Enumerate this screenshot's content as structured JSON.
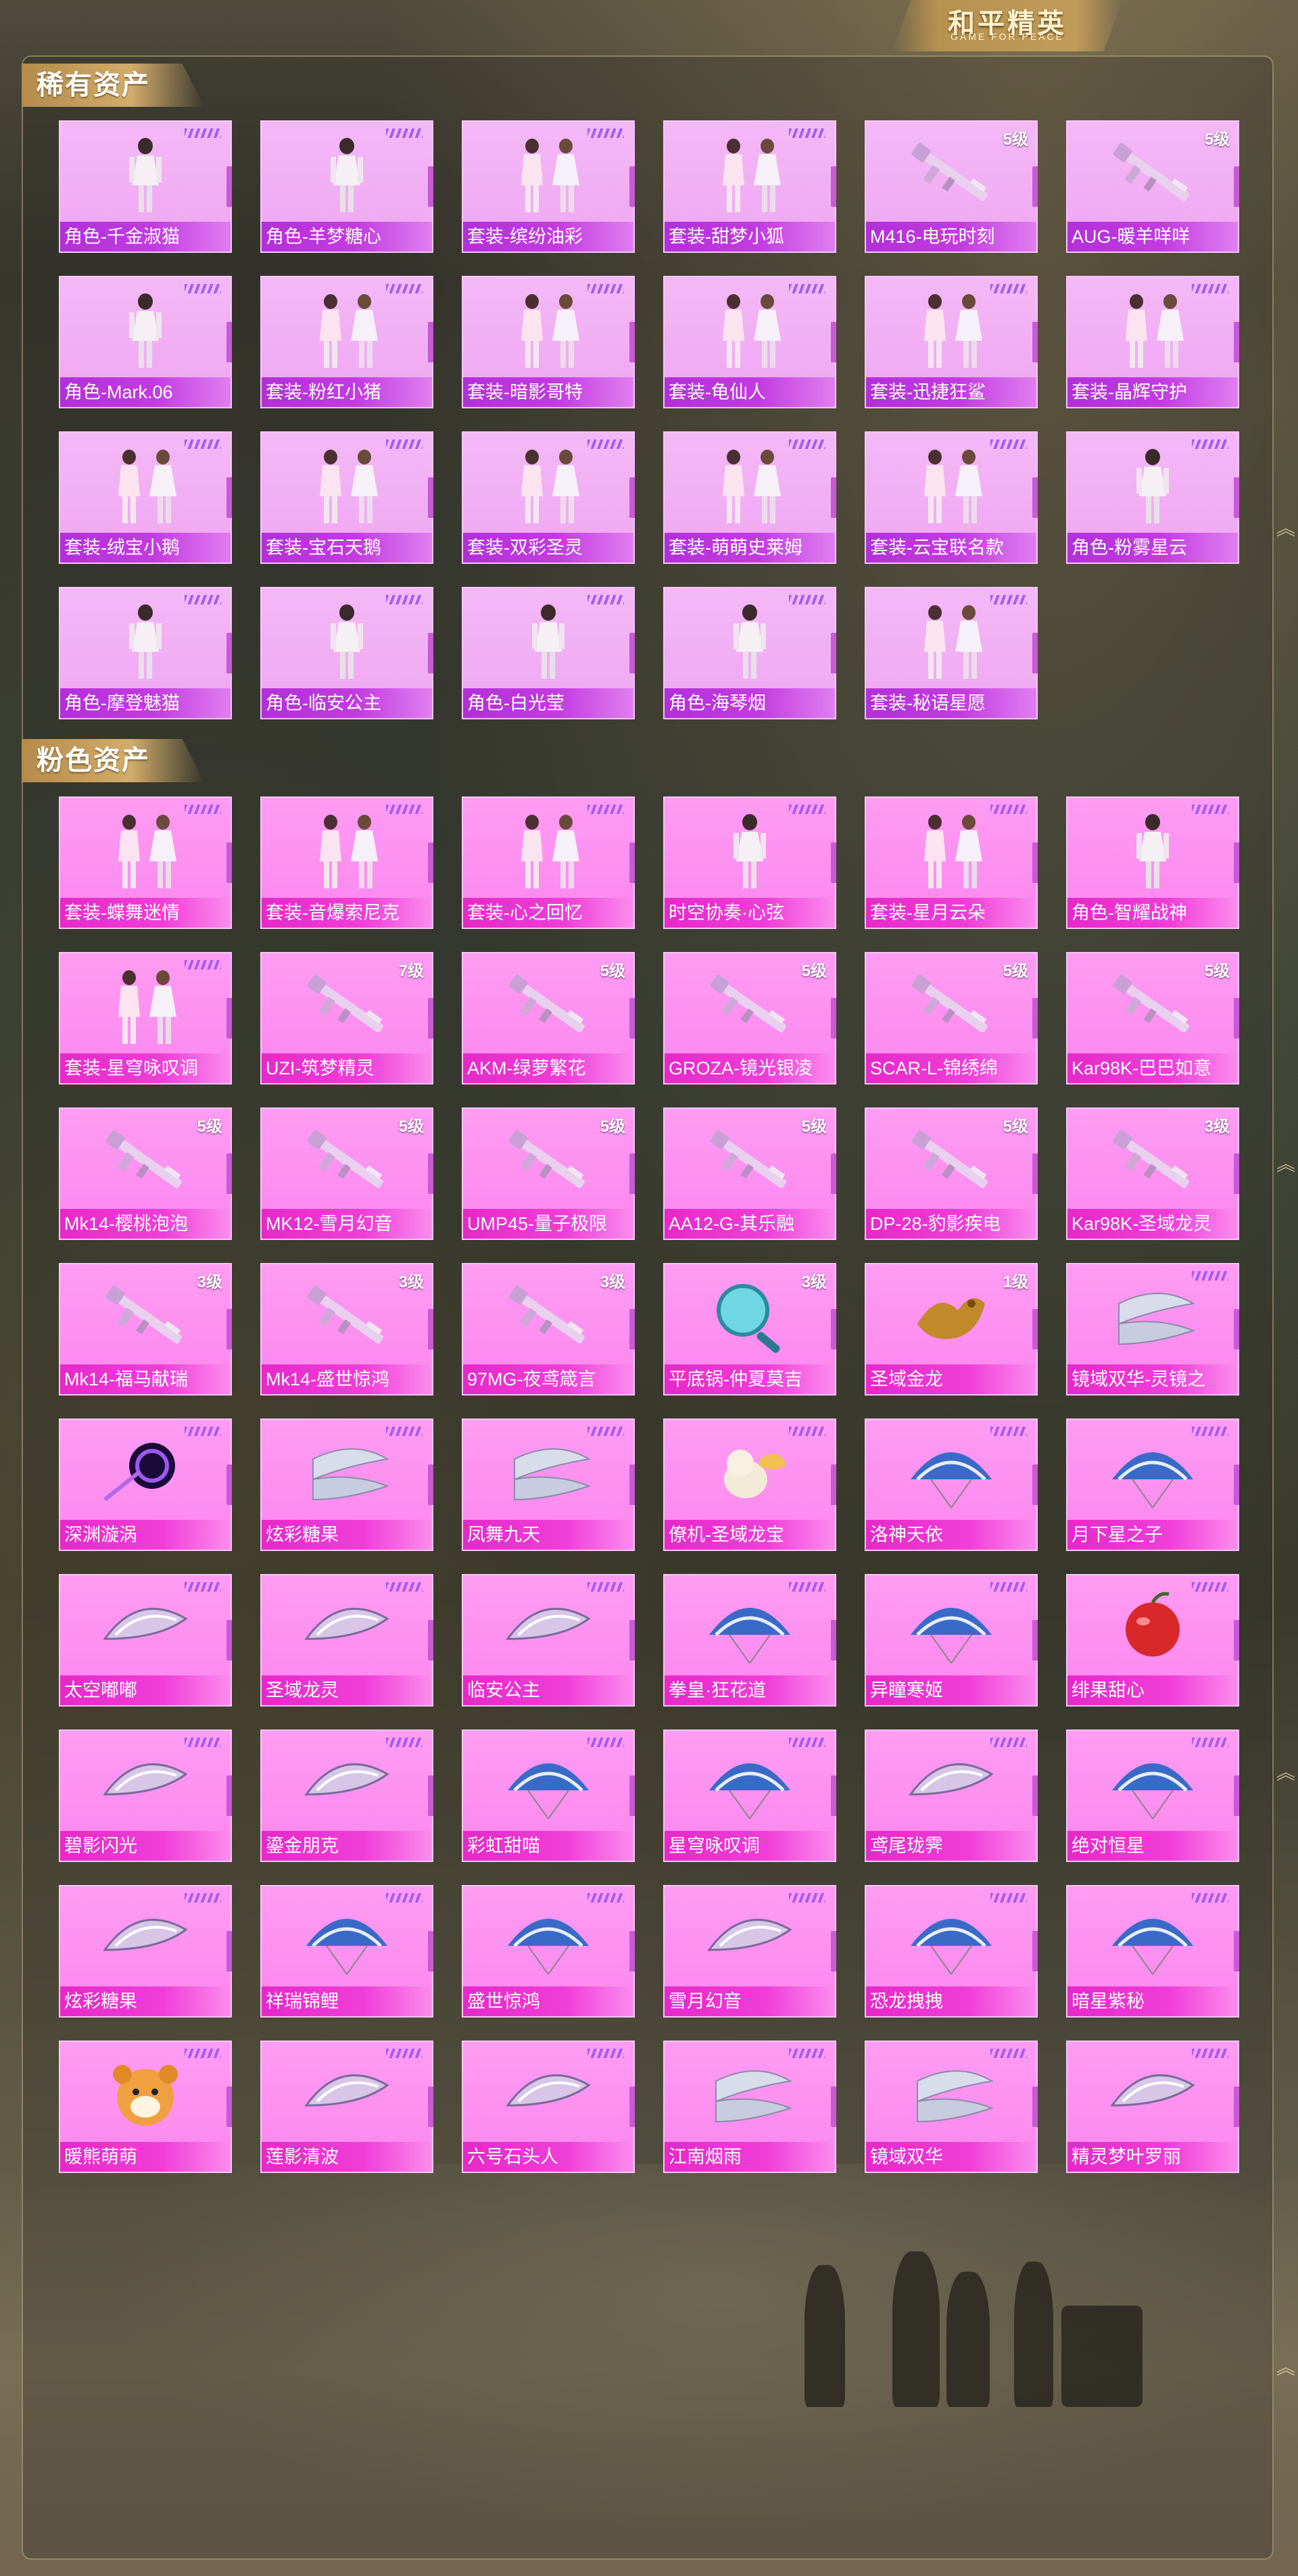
{
  "header": {
    "logo_title": "和平精英",
    "logo_subtitle": "GAME FOR PEACE"
  },
  "sections": {
    "rare": {
      "title": "稀有资产",
      "items": [
        {
          "label": "角色-千金淑猫",
          "level": "",
          "art": "figure"
        },
        {
          "label": "角色-羊梦糖心",
          "level": "",
          "art": "figure"
        },
        {
          "label": "套装-缤纷油彩",
          "level": "",
          "art": "pair"
        },
        {
          "label": "套装-甜梦小狐",
          "level": "",
          "art": "pair"
        },
        {
          "label": "M416-电玩时刻",
          "level": "5级",
          "art": "gun"
        },
        {
          "label": "AUG-暖羊咩咩",
          "level": "5级",
          "art": "gun"
        },
        {
          "label": "角色-Mark.06",
          "level": "",
          "art": "figure"
        },
        {
          "label": "套装-粉红小猪",
          "level": "",
          "art": "pair"
        },
        {
          "label": "套装-暗影哥特",
          "level": "",
          "art": "pair"
        },
        {
          "label": "套装-龟仙人",
          "level": "",
          "art": "pair"
        },
        {
          "label": "套装-迅捷狂鲨",
          "level": "",
          "art": "pair"
        },
        {
          "label": "套装-晶辉守护",
          "level": "",
          "art": "pair"
        },
        {
          "label": "套装-绒宝小鹅",
          "level": "",
          "art": "pair"
        },
        {
          "label": "套装-宝石天鹅",
          "level": "",
          "art": "pair"
        },
        {
          "label": "套装-双彩圣灵",
          "level": "",
          "art": "pair"
        },
        {
          "label": "套装-萌萌史莱姆",
          "level": "",
          "art": "pair"
        },
        {
          "label": "套装-云宝联名款",
          "level": "",
          "art": "pair"
        },
        {
          "label": "角色-粉雾星云",
          "level": "",
          "art": "figure"
        },
        {
          "label": "角色-摩登魅猫",
          "level": "",
          "art": "figure"
        },
        {
          "label": "角色-临安公主",
          "level": "",
          "art": "figure"
        },
        {
          "label": "角色-白光莹",
          "level": "",
          "art": "figure"
        },
        {
          "label": "角色-海琴烟",
          "level": "",
          "art": "figure"
        },
        {
          "label": "套装-秘语星愿",
          "level": "",
          "art": "pair"
        }
      ]
    },
    "pink": {
      "title": "粉色资产",
      "items": [
        {
          "label": "套装-蝶舞迷情",
          "level": "",
          "art": "pair"
        },
        {
          "label": "套装-音爆索尼克",
          "level": "",
          "art": "pair"
        },
        {
          "label": "套装-心之回忆",
          "level": "",
          "art": "pair"
        },
        {
          "label": "时空协奏·心弦",
          "level": "",
          "art": "figure"
        },
        {
          "label": "套装-星月云朵",
          "level": "",
          "art": "pair"
        },
        {
          "label": "角色-智耀战神",
          "level": "",
          "art": "figure"
        },
        {
          "label": "套装-星穹咏叹调",
          "level": "",
          "art": "pair"
        },
        {
          "label": "UZI-筑梦精灵",
          "level": "7级",
          "art": "gun"
        },
        {
          "label": "AKM-绿萝繁花",
          "level": "5级",
          "art": "gun"
        },
        {
          "label": "GROZA-镜光银凌",
          "level": "5级",
          "art": "gun"
        },
        {
          "label": "SCAR-L-锦绣绵",
          "level": "5级",
          "art": "gun"
        },
        {
          "label": "Kar98K-巴巴如意",
          "level": "5级",
          "art": "gun"
        },
        {
          "label": "Mk14-樱桃泡泡",
          "level": "5级",
          "art": "gun"
        },
        {
          "label": "MK12-雪月幻音",
          "level": "5级",
          "art": "gun"
        },
        {
          "label": "UMP45-量子极限",
          "level": "5级",
          "art": "gun"
        },
        {
          "label": "AA12-G-其乐融",
          "level": "5级",
          "art": "gun"
        },
        {
          "label": "DP-28-豹影疾电",
          "level": "5级",
          "art": "gun"
        },
        {
          "label": "Kar98K-圣域龙灵",
          "level": "3级",
          "art": "gun"
        },
        {
          "label": "Mk14-福马献瑞",
          "level": "3级",
          "art": "gun"
        },
        {
          "label": "Mk14-盛世惊鸿",
          "level": "3级",
          "art": "gun"
        },
        {
          "label": "97MG-夜鸢箴言",
          "level": "3级",
          "art": "gun"
        },
        {
          "label": "平底锅-仲夏莫吉",
          "level": "3级",
          "art": "pan"
        },
        {
          "label": "圣域金龙",
          "level": "1级",
          "art": "dragon"
        },
        {
          "label": "镜域双华-灵镜之",
          "level": "",
          "art": "wings"
        },
        {
          "label": "深渊漩涡",
          "level": "",
          "art": "vortex"
        },
        {
          "label": "炫彩糖果",
          "level": "",
          "art": "wings"
        },
        {
          "label": "凤舞九天",
          "level": "",
          "art": "wings"
        },
        {
          "label": "僚机-圣域龙宝",
          "level": "",
          "art": "pet"
        },
        {
          "label": "洛神天依",
          "level": "",
          "art": "chute"
        },
        {
          "label": "月下星之子",
          "level": "",
          "art": "chute"
        },
        {
          "label": "太空嘟嘟",
          "level": "",
          "art": "glider"
        },
        {
          "label": "圣域龙灵",
          "level": "",
          "art": "glider"
        },
        {
          "label": "临安公主",
          "level": "",
          "art": "glider"
        },
        {
          "label": "拳皇·狂花道",
          "level": "",
          "art": "chute"
        },
        {
          "label": "异瞳寒姬",
          "level": "",
          "art": "chute"
        },
        {
          "label": "绯果甜心",
          "level": "",
          "art": "apple"
        },
        {
          "label": "碧影闪光",
          "level": "",
          "art": "glider"
        },
        {
          "label": "鎏金朋克",
          "level": "",
          "art": "glider"
        },
        {
          "label": "彩虹甜喵",
          "level": "",
          "art": "chute"
        },
        {
          "label": "星穹咏叹调",
          "level": "",
          "art": "chute"
        },
        {
          "label": "鸢尾珑霁",
          "level": "",
          "art": "glider"
        },
        {
          "label": "绝对恒星",
          "level": "",
          "art": "chute"
        },
        {
          "label": "炫彩糖果",
          "level": "",
          "art": "glider"
        },
        {
          "label": "祥瑞锦鲤",
          "level": "",
          "art": "chute"
        },
        {
          "label": "盛世惊鸿",
          "level": "",
          "art": "chute"
        },
        {
          "label": "雪月幻音",
          "level": "",
          "art": "glider"
        },
        {
          "label": "恐龙拽拽",
          "level": "",
          "art": "chute"
        },
        {
          "label": "暗星紫秘",
          "level": "",
          "art": "chute"
        },
        {
          "label": "暖熊萌萌",
          "level": "",
          "art": "bear"
        },
        {
          "label": "莲影清波",
          "level": "",
          "art": "glider"
        },
        {
          "label": "六号石头人",
          "level": "",
          "art": "glider"
        },
        {
          "label": "江南烟雨",
          "level": "",
          "art": "wings"
        },
        {
          "label": "镜域双华",
          "level": "",
          "art": "wings"
        },
        {
          "label": "精灵梦叶罗丽",
          "level": "",
          "art": "glider"
        }
      ]
    }
  },
  "colors": {
    "card_rare": "#f2b3f4",
    "card_pink": "#fb86ee",
    "label_bar": "#c23be0",
    "accent_gold": "#c8a25e"
  }
}
